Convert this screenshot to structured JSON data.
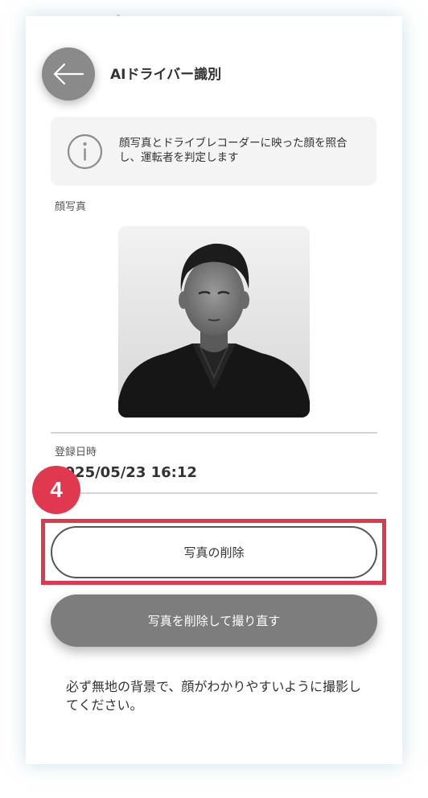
{
  "colors": {
    "accent": "#e0394f",
    "back_button": "#8a8a8a",
    "retake_button": "#7d7d7d",
    "info_bg": "#f4f4f4",
    "text": "#333333"
  },
  "header": {
    "back_icon": "arrow-left-icon",
    "title": "AIドライバー識別"
  },
  "info": {
    "icon": "info-circle-icon",
    "text": "顔写真とドライブレコーダーに映った顔を照合し、運転者を判定します"
  },
  "photo_section": {
    "label": "顔写真"
  },
  "registration": {
    "label": "登録日時",
    "value": "2025/05/23 16:12"
  },
  "step_badge": "4",
  "buttons": {
    "delete_label": "写真の削除",
    "retake_label": "写真を削除して撮り直す"
  },
  "note": "必ず無地の背景で、顔がわかりやすいように撮影してください。"
}
